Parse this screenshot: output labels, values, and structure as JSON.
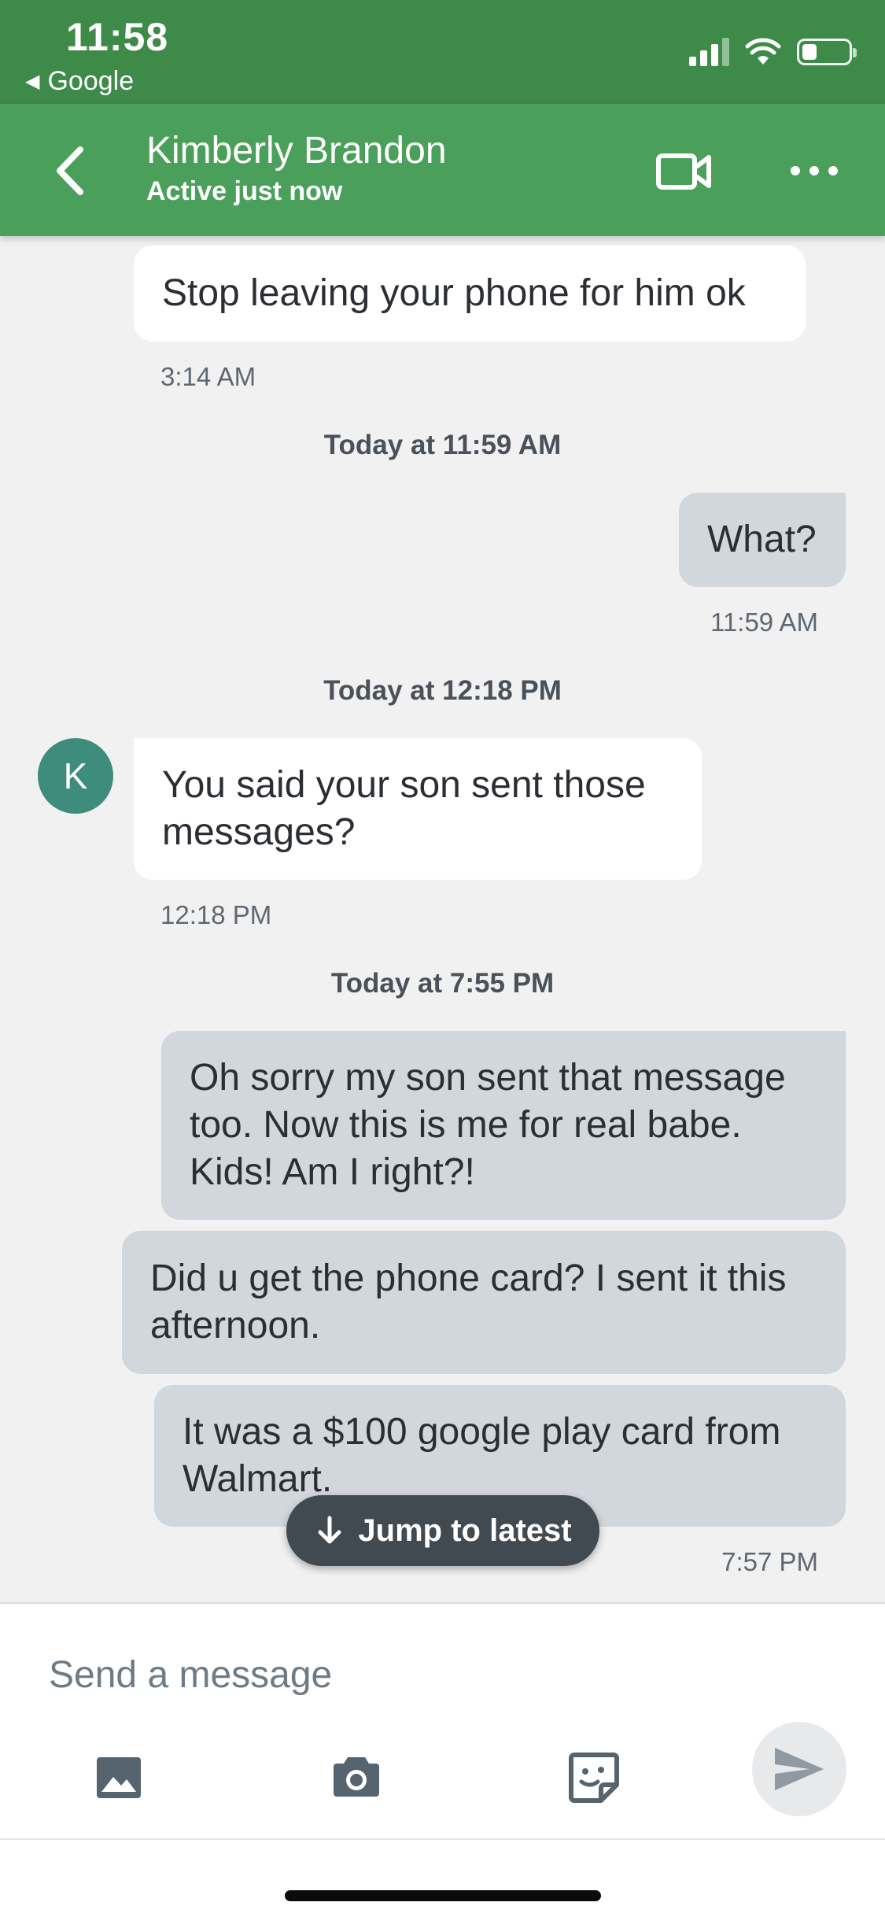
{
  "status_bar": {
    "time": "11:58",
    "back_app_label": "Google",
    "icons": [
      "cellular-signal-icon",
      "wifi-icon",
      "battery-icon"
    ],
    "battery_level": 0.25
  },
  "header": {
    "contact_name": "Kimberly Brandon",
    "contact_status": "Active just now",
    "icons": [
      "back-chevron-icon",
      "video-camera-icon",
      "more-horizontal-icon"
    ],
    "accent_color": "#4aa05a",
    "status_bar_color": "#3e8a49"
  },
  "conversation": {
    "messages": [
      {
        "direction": "incoming",
        "text": "Stop leaving your phone for him ok"
      },
      {
        "direction": "outgoing",
        "text": "What?"
      },
      {
        "direction": "incoming",
        "text": "You said your son sent those messages?"
      },
      {
        "direction": "outgoing",
        "text": "Oh sorry my son sent that message too. Now this is me for real babe. Kids! Am I right?!"
      },
      {
        "direction": "outgoing",
        "text": "Did u get the phone card? I sent it this afternoon."
      },
      {
        "direction": "outgoing",
        "text": "It was a $100 google play card from Walmart."
      }
    ],
    "timestamps": [
      "3:14 AM",
      "11:59 AM",
      "12:18 PM",
      "7:57 PM"
    ],
    "dividers": [
      "Today at 11:59 AM",
      "Today at 12:18 PM",
      "Today at 7:55 PM"
    ],
    "avatar_initial": "K",
    "avatar_color": "#3d8c7c",
    "jump_to_latest_label": "Jump to latest"
  },
  "composer": {
    "placeholder": "Send a message",
    "value": "",
    "tools": [
      "image-gallery-icon",
      "camera-icon",
      "sticker-icon",
      "send-icon"
    ]
  }
}
